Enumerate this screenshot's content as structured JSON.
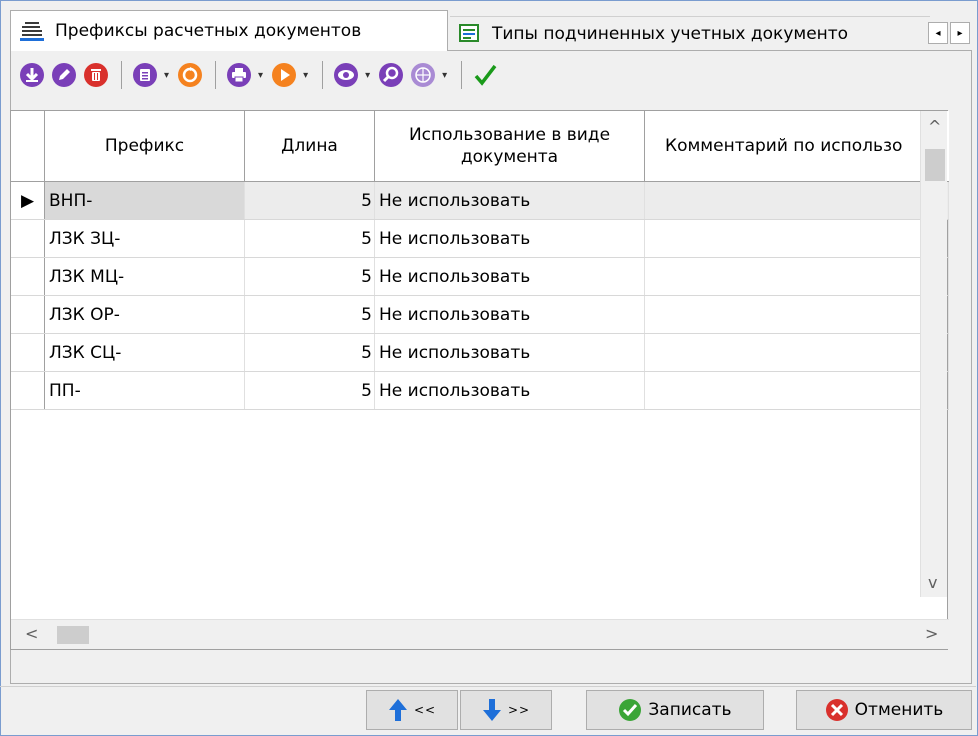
{
  "tabs": [
    {
      "label": "Префиксы расчетных документов",
      "icon": "document-prefix-icon",
      "active": true
    },
    {
      "label": "Типы подчиненных учетных документо",
      "icon": "document-types-icon",
      "active": false
    }
  ],
  "tab_scroll": {
    "left": "◂",
    "right": "▸"
  },
  "toolbar": {
    "tools": [
      "add-icon",
      "edit-icon",
      "delete-icon",
      "copy-icon",
      "refresh-icon",
      "print-icon",
      "run-icon",
      "view-icon",
      "search-icon",
      "globe-icon",
      "confirm-icon"
    ],
    "drop_glyph": "▾"
  },
  "table": {
    "columns": [
      "Префикс",
      "Длина",
      "Использование в виде документа",
      "Комментарий по использо"
    ],
    "rows": [
      {
        "prefix": "ВНП-",
        "length": "5",
        "usage": "Не использовать",
        "comment": ""
      },
      {
        "prefix": "ЛЗК ЗЦ-",
        "length": "5",
        "usage": "Не использовать",
        "comment": ""
      },
      {
        "prefix": "ЛЗК МЦ-",
        "length": "5",
        "usage": "Не использовать",
        "comment": ""
      },
      {
        "prefix": "ЛЗК ОР-",
        "length": "5",
        "usage": "Не использовать",
        "comment": ""
      },
      {
        "prefix": "ЛЗК СЦ-",
        "length": "5",
        "usage": "Не использовать",
        "comment": ""
      },
      {
        "prefix": "ПП-",
        "length": "5",
        "usage": "Не использовать",
        "comment": ""
      }
    ],
    "selected_row": 0,
    "row_pointer": "▶"
  },
  "scroll": {
    "up": "^",
    "down": "v",
    "left": "<",
    "right": ">"
  },
  "footer": {
    "prev_label": "<<",
    "next_label": ">>",
    "save_label": "Записать",
    "cancel_label": "Отменить"
  },
  "colors": {
    "blue": "#1e6fd9",
    "orange": "#f5821f",
    "red": "#d9302c",
    "purple": "#7a3fb8",
    "green": "#3aa537",
    "check": "#1a9a1a"
  }
}
